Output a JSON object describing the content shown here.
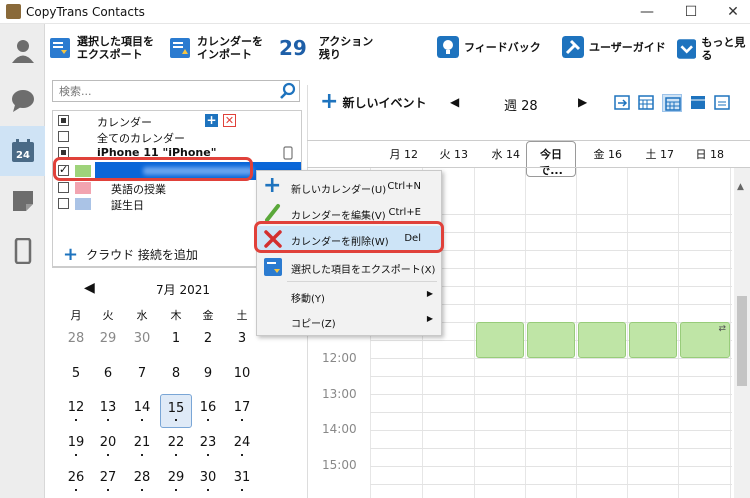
{
  "window": {
    "title": "CopyTrans Contacts",
    "minimize": "—",
    "maximize": "☐",
    "close": "✕"
  },
  "toolbar": {
    "export_line1": "選択した項目を",
    "export_line2": "エクスポート",
    "import_line1": "カレンダーを",
    "import_line2": "インポート",
    "actions_count": "29",
    "actions_line1": "アクション",
    "actions_line2": "残り",
    "feedback": "フィードバック",
    "user_guide": "ユーザーガイド",
    "more": "もっと見る"
  },
  "search": {
    "placeholder": "検索..."
  },
  "calendar_list": {
    "header": "カレンダー",
    "all_calendars": "全てのカレンダー",
    "device": "iPhone 11 \"iPhone\"",
    "items": [
      {
        "label": "",
        "color": "#9ed37a",
        "checked": true,
        "selected": true
      },
      {
        "label": "英語の授業",
        "color": "#f2a4b0",
        "checked": false
      },
      {
        "label": "誕生日",
        "color": "#aac3e6",
        "checked": false
      }
    ],
    "add_cloud": "クラウド 接続を追加"
  },
  "minical": {
    "month": "7月  2021",
    "weekdays": [
      "月",
      "火",
      "水",
      "木",
      "金",
      "土"
    ],
    "weeks": [
      [
        "28",
        "29",
        "30",
        "1",
        "2",
        "3"
      ],
      [
        "5",
        "6",
        "7",
        "8",
        "9",
        "10"
      ],
      [
        "12",
        "13",
        "14",
        "15",
        "16",
        "17"
      ],
      [
        "19",
        "20",
        "21",
        "22",
        "23",
        "24"
      ],
      [
        "26",
        "27",
        "28",
        "29",
        "30",
        "31"
      ]
    ],
    "today": "15"
  },
  "calendar_view": {
    "new_event": "新しいイベント",
    "week_label": "週 28",
    "days": [
      "月 12",
      "火 13",
      "水 14",
      "今日 で...",
      "金 16",
      "土 17",
      "日 18"
    ],
    "times": [
      "12:00",
      "13:00",
      "14:00",
      "15:00"
    ]
  },
  "context_menu": {
    "items": [
      {
        "label": "新しいカレンダー(U)",
        "shortcut": "Ctrl+N"
      },
      {
        "label": "カレンダーを編集(V)",
        "shortcut": "Ctrl+E"
      },
      {
        "label": "カレンダーを削除(W)",
        "shortcut": "Del"
      },
      {
        "label": "選択した項目をエクスポート(X)",
        "shortcut": ""
      },
      {
        "label": "移動(Y)",
        "shortcut": ""
      },
      {
        "label": "コピー(Z)",
        "shortcut": ""
      }
    ]
  },
  "colors": {
    "accent": "#1e73be",
    "highlight": "#e0413a",
    "selection": "#0a66d8"
  }
}
